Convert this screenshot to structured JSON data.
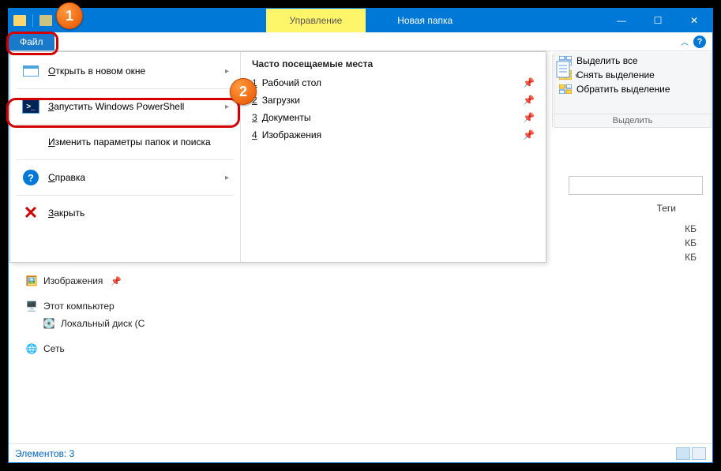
{
  "titlebar": {
    "context_tab": "Управление",
    "window_title": "Новая папка"
  },
  "tabs": {
    "file": "Файл"
  },
  "ribbon_select_group": {
    "title": "Выделить",
    "select_all": "Выделить все",
    "select_none": "Снять выделение",
    "invert": "Обратить выделение"
  },
  "file_menu": {
    "open_new_window_pre": "О",
    "open_new_window_rest": "ткрыть в новом окне",
    "powershell_pre": "З",
    "powershell_rest": "апустить Windows PowerShell",
    "options_pre": "И",
    "options_rest": "зменить параметры папок и поиска",
    "help_pre": "С",
    "help_rest": "правка",
    "close_pre": "З",
    "close_rest": "акрыть"
  },
  "frequent": {
    "header": "Часто посещаемые места",
    "items": [
      {
        "n": "1",
        "label": "Рабочий стол"
      },
      {
        "n": "2",
        "label": "Загрузки"
      },
      {
        "n": "3",
        "label": "Документы"
      },
      {
        "n": "4",
        "label": "Изображения"
      }
    ]
  },
  "nav": {
    "pictures": "Изображения",
    "this_pc": "Этот компьютер",
    "local_disk": "Локальный диск (C",
    "network": "Сеть"
  },
  "list": {
    "header_tags": "Теги",
    "sizes": [
      "КБ",
      "КБ",
      "КБ"
    ]
  },
  "statusbar": {
    "items": "Элементов: 3"
  },
  "badges": {
    "one": "1",
    "two": "2"
  }
}
